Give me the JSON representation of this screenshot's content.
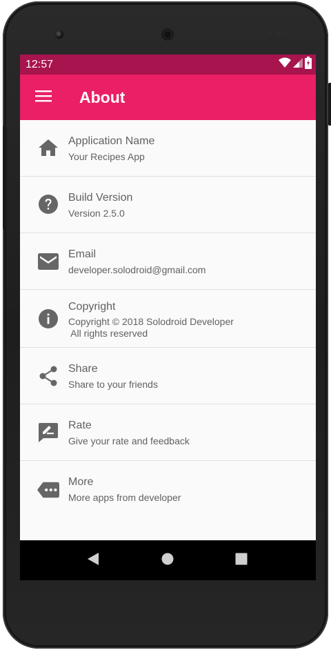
{
  "status_bar": {
    "time": "12:57"
  },
  "app_bar": {
    "title": "About"
  },
  "items": [
    {
      "label": "Application Name",
      "sub": "Your Recipes App",
      "icon": "home-icon"
    },
    {
      "label": "Build Version",
      "sub": "Version 2.5.0",
      "icon": "help-icon"
    },
    {
      "label": "Email",
      "sub": "developer.solodroid@gmail.com",
      "icon": "email-icon"
    },
    {
      "label": "Copyright",
      "sub": "Copyright © 2018 Solodroid Developer\n All rights reserved",
      "icon": "info-icon"
    },
    {
      "label": "Share",
      "sub": "Share to your friends",
      "icon": "share-icon"
    },
    {
      "label": "Rate",
      "sub": "Give your rate and feedback",
      "icon": "rate-review-icon"
    },
    {
      "label": "More",
      "sub": "More apps from developer",
      "icon": "more-icon"
    }
  ],
  "colors": {
    "primary": "#ea1f65",
    "primary_dark": "#a8144d",
    "icon_gray": "#666666",
    "text_gray": "#616161"
  }
}
